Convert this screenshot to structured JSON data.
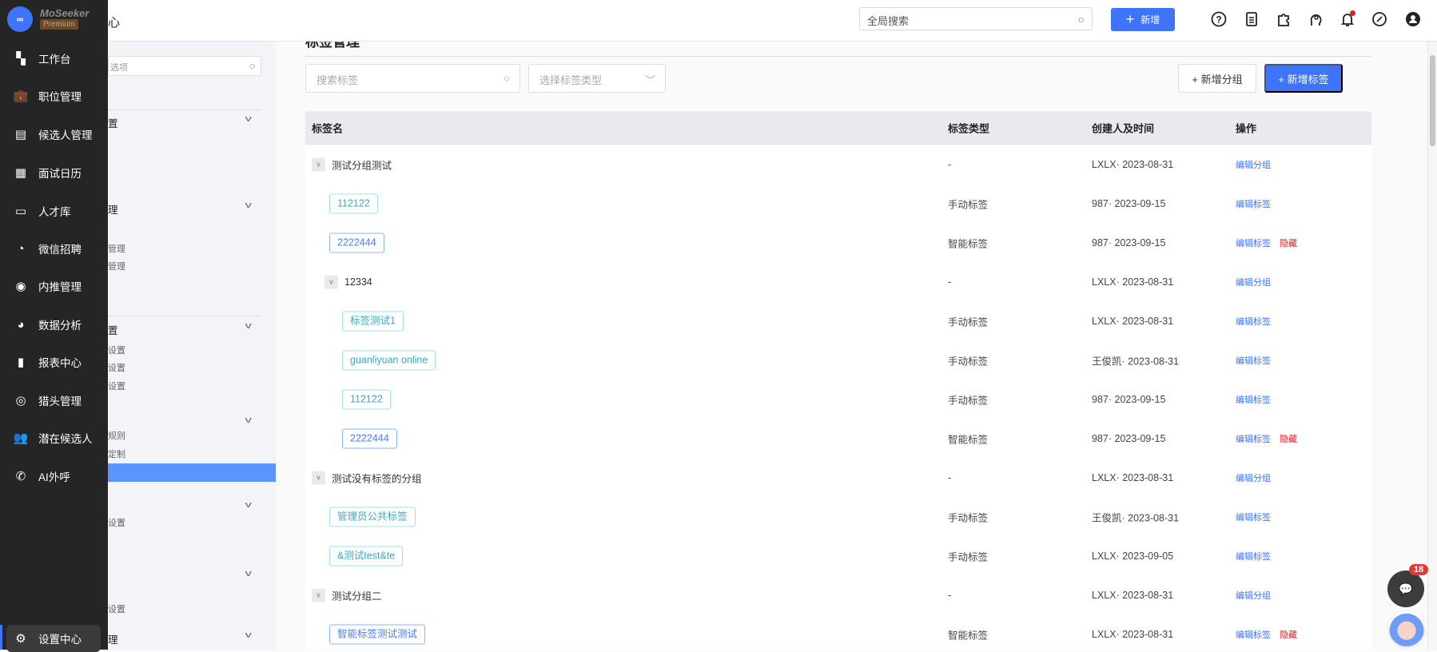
{
  "header": {
    "title_fragment": "心",
    "global_search_placeholder": "全局搜索",
    "add_label": "新增"
  },
  "brand": {
    "name": "MoSeeker",
    "tier": "Premium",
    "logo_text": "∞"
  },
  "nav": [
    {
      "label": "工作台",
      "icon": "dashboard-icon"
    },
    {
      "label": "职位管理",
      "icon": "briefcase-icon"
    },
    {
      "label": "候选人管理",
      "icon": "candidate-file-icon"
    },
    {
      "label": "面试日历",
      "icon": "calendar-icon"
    },
    {
      "label": "人才库",
      "icon": "id-card-icon"
    },
    {
      "label": "微信招聘",
      "icon": "wechat-icon"
    },
    {
      "label": "内推管理",
      "icon": "thumbs-up-icon"
    },
    {
      "label": "数据分析",
      "icon": "pie-chart-icon"
    },
    {
      "label": "报表中心",
      "icon": "bar-chart-icon"
    },
    {
      "label": "猎头管理",
      "icon": "headhunter-icon"
    },
    {
      "label": "潜在候选人",
      "icon": "people-icon"
    },
    {
      "label": "AI外呼",
      "icon": "phone-icon"
    }
  ],
  "nav_active": {
    "label": "设置中心",
    "icon": "gear-icon"
  },
  "subnav": {
    "search_placeholder_fragment": "选项",
    "fragments": [
      {
        "text": "置",
        "header": true
      },
      {
        "text": "理",
        "header": true
      },
      {
        "text": "管理"
      },
      {
        "text": "管理"
      },
      {
        "text": "置",
        "header": true
      },
      {
        "text": "设置"
      },
      {
        "text": "设置"
      },
      {
        "text": "设置"
      },
      {
        "text": "规则"
      },
      {
        "text": "定制"
      },
      {
        "text": "设置"
      },
      {
        "text": "设置"
      },
      {
        "text": "理",
        "header": true
      }
    ]
  },
  "page": {
    "title": "标签管理",
    "search_placeholder": "搜索标签",
    "type_select_placeholder": "选择标签类型",
    "add_group_label": "+ 新增分组",
    "add_tag_label": "+ 新增标签"
  },
  "table": {
    "columns": [
      "标签名",
      "标签类型",
      "创建人及时间",
      "操作"
    ],
    "rows": [
      {
        "kind": "group",
        "level": 0,
        "name": "测试分组测试",
        "type": "-",
        "creator": "LXLX· 2023-08-31",
        "ops": [
          "编辑分组"
        ]
      },
      {
        "kind": "tag",
        "style": "manual",
        "level": 1,
        "name": "112122",
        "type": "手动标签",
        "creator": "987· 2023-09-15",
        "ops": [
          "编辑标签"
        ]
      },
      {
        "kind": "tag",
        "style": "smart",
        "level": 1,
        "name": "2222444",
        "type": "智能标签",
        "creator": "987· 2023-09-15",
        "ops": [
          "编辑标签",
          "隐藏"
        ]
      },
      {
        "kind": "group",
        "level": 1,
        "name": "12334",
        "type": "-",
        "creator": "LXLX· 2023-08-31",
        "ops": [
          "编辑分组"
        ]
      },
      {
        "kind": "tag",
        "style": "manual",
        "level": 2,
        "name": "标签测试1",
        "type": "手动标签",
        "creator": "LXLX· 2023-08-31",
        "ops": [
          "编辑标签"
        ]
      },
      {
        "kind": "tag",
        "style": "manual",
        "level": 2,
        "name": "guanliyuan online",
        "type": "手动标签",
        "creator": "王俊凯· 2023-08-31",
        "ops": [
          "编辑标签"
        ]
      },
      {
        "kind": "tag",
        "style": "manual",
        "level": 2,
        "name": "112122",
        "type": "手动标签",
        "creator": "987· 2023-09-15",
        "ops": [
          "编辑标签"
        ]
      },
      {
        "kind": "tag",
        "style": "smart",
        "level": 2,
        "name": "2222444",
        "type": "智能标签",
        "creator": "987· 2023-09-15",
        "ops": [
          "编辑标签",
          "隐藏"
        ]
      },
      {
        "kind": "group",
        "level": 0,
        "name": "测试没有标签的分组",
        "type": "-",
        "creator": "LXLX· 2023-08-31",
        "ops": [
          "编辑分组"
        ]
      },
      {
        "kind": "tag",
        "style": "manual",
        "level": 1,
        "name": "管理员公共标签",
        "type": "手动标签",
        "creator": "王俊凯· 2023-08-31",
        "ops": [
          "编辑标签"
        ]
      },
      {
        "kind": "tag",
        "style": "manual",
        "level": 1,
        "name": "&测试test&te",
        "type": "手动标签",
        "creator": "LXLX· 2023-09-05",
        "ops": [
          "编辑标签"
        ]
      },
      {
        "kind": "group",
        "level": 0,
        "name": "测试分组二",
        "type": "-",
        "creator": "LXLX· 2023-08-31",
        "ops": [
          "编辑分组"
        ]
      },
      {
        "kind": "tag",
        "style": "smart",
        "level": 1,
        "name": "智能标签测试测试",
        "type": "智能标签",
        "creator": "LXLX· 2023-08-31",
        "ops": [
          "编辑标签",
          "隐藏"
        ]
      }
    ]
  },
  "chat": {
    "unread": "18"
  },
  "colors": {
    "primary": "#3d74fb",
    "danger": "#e02020",
    "sidebar": "#252525",
    "manual_tag": "#3aa8c4",
    "smart_tag": "#4a7cf5"
  }
}
